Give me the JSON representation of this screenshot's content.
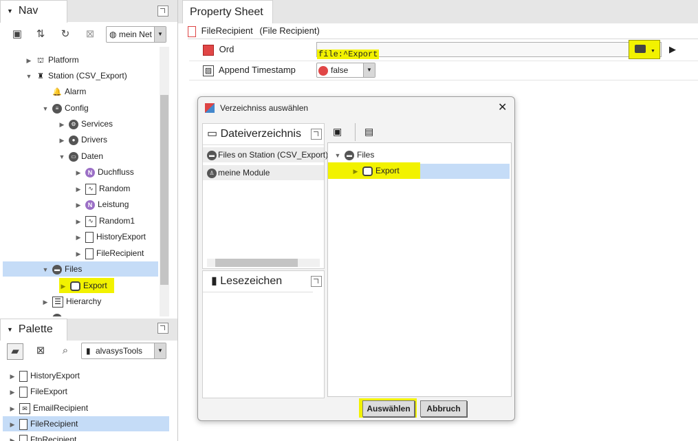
{
  "nav": {
    "title": "Nav",
    "network_select": "mein Net",
    "tree": [
      {
        "label": "Platform"
      },
      {
        "label": "Station (CSV_Export)"
      },
      {
        "label": "Alarm"
      },
      {
        "label": "Config"
      },
      {
        "label": "Services"
      },
      {
        "label": "Drivers"
      },
      {
        "label": "Daten"
      },
      {
        "label": "Duchfluss"
      },
      {
        "label": "Random"
      },
      {
        "label": "Leistung"
      },
      {
        "label": "Random1"
      },
      {
        "label": "HistoryExport"
      },
      {
        "label": "FileRecipient"
      },
      {
        "label": "Files"
      },
      {
        "label": "Export"
      },
      {
        "label": "Hierarchy"
      }
    ]
  },
  "palette": {
    "title": "Palette",
    "module_select": "alvasysTools",
    "items": [
      {
        "label": "HistoryExport"
      },
      {
        "label": "FileExport"
      },
      {
        "label": "EmailRecipient"
      },
      {
        "label": "FileRecipient"
      },
      {
        "label": "FtpRecipient"
      }
    ]
  },
  "property_sheet": {
    "tab": "Property Sheet",
    "object_name": "FileRecipient",
    "object_type": "(File Recipient)",
    "rows": [
      {
        "label": "Ord",
        "value": "file:^Export"
      },
      {
        "label": "Append Timestamp",
        "value": "false"
      }
    ]
  },
  "dialog": {
    "title": "Verzeichniss auswählen",
    "left_top_title": "Dateiverzeichnis",
    "sources": [
      {
        "label": "Files on Station (CSV_Export)"
      },
      {
        "label": "meine Module"
      }
    ],
    "bookmarks_title": "Lesezeichen",
    "tree": [
      {
        "label": "Files"
      },
      {
        "label": "Export"
      }
    ],
    "ok_label": "Auswählen",
    "cancel_label": "Abbruch"
  },
  "colors": {
    "highlight": "#f2f200",
    "selection": "#c5dcf7",
    "status_red": "#e04646"
  }
}
